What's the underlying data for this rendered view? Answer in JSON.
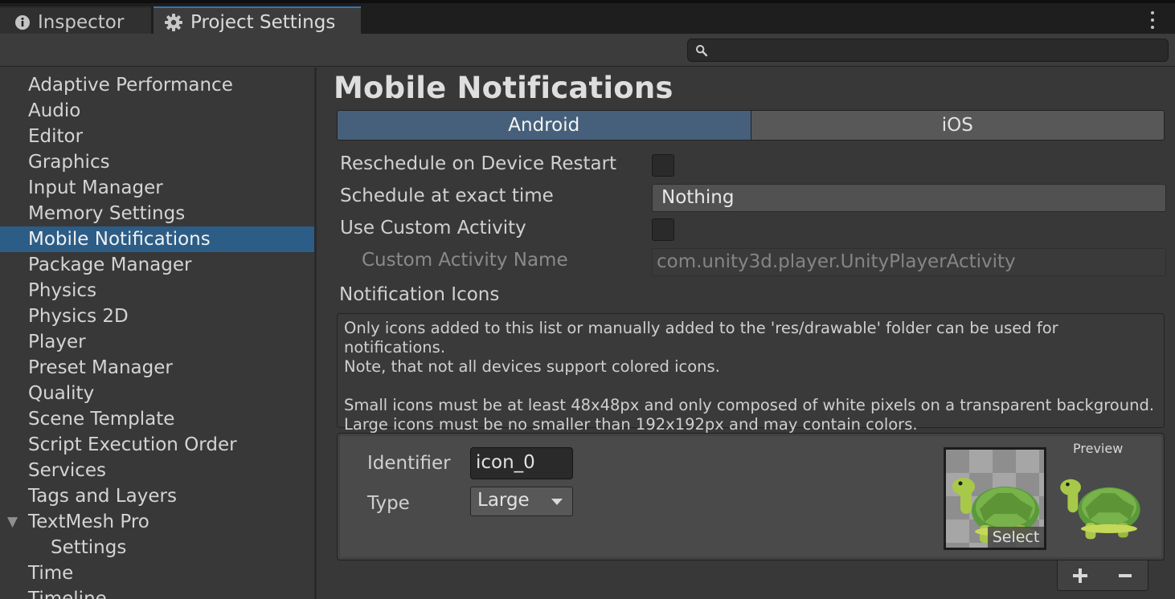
{
  "tabs": {
    "inspector": "Inspector",
    "project_settings": "Project Settings"
  },
  "search": {
    "placeholder": ""
  },
  "sidebar": {
    "items": [
      {
        "label": "Adaptive Performance"
      },
      {
        "label": "Audio"
      },
      {
        "label": "Editor"
      },
      {
        "label": "Graphics"
      },
      {
        "label": "Input Manager"
      },
      {
        "label": "Memory Settings"
      },
      {
        "label": "Mobile Notifications",
        "selected": true
      },
      {
        "label": "Package Manager"
      },
      {
        "label": "Physics"
      },
      {
        "label": "Physics 2D"
      },
      {
        "label": "Player"
      },
      {
        "label": "Preset Manager"
      },
      {
        "label": "Quality"
      },
      {
        "label": "Scene Template"
      },
      {
        "label": "Script Execution Order"
      },
      {
        "label": "Services"
      },
      {
        "label": "Tags and Layers"
      },
      {
        "label": "TextMesh Pro",
        "expanded": true
      },
      {
        "label": "Settings",
        "child": true
      },
      {
        "label": "Time"
      },
      {
        "label": "Timeline"
      }
    ]
  },
  "main": {
    "title": "Mobile Notifications",
    "platform_tabs": [
      "Android",
      "iOS"
    ],
    "active_platform": "Android",
    "fields": {
      "reschedule_label": "Reschedule on Device Restart",
      "reschedule_checked": false,
      "exact_time_label": "Schedule at exact time",
      "exact_time_value": "Nothing",
      "custom_activity_label": "Use Custom Activity",
      "custom_activity_checked": false,
      "custom_activity_name_label": "Custom Activity Name",
      "custom_activity_name_value": "com.unity3d.player.UnityPlayerActivity"
    },
    "notification_icons": {
      "label": "Notification Icons",
      "help_line1": "Only icons added to this list or manually added to the 'res/drawable' folder can be used for notifications.",
      "help_line2": "Note, that not all devices support colored icons.",
      "help_line3": "Small icons must be at least 48x48px and only composed of white pixels on a transparent background.",
      "help_line4": "Large icons must be no smaller than 192x192px and may contain colors.",
      "identifier_label": "Identifier",
      "identifier_value": "icon_0",
      "type_label": "Type",
      "type_value": "Large",
      "select_label": "Select",
      "preview_label": "Preview",
      "add_symbol": "+",
      "remove_symbol": "−"
    }
  },
  "colors": {
    "selection": "#2c5d87",
    "active_tab": "#46607c",
    "background": "#383838"
  }
}
